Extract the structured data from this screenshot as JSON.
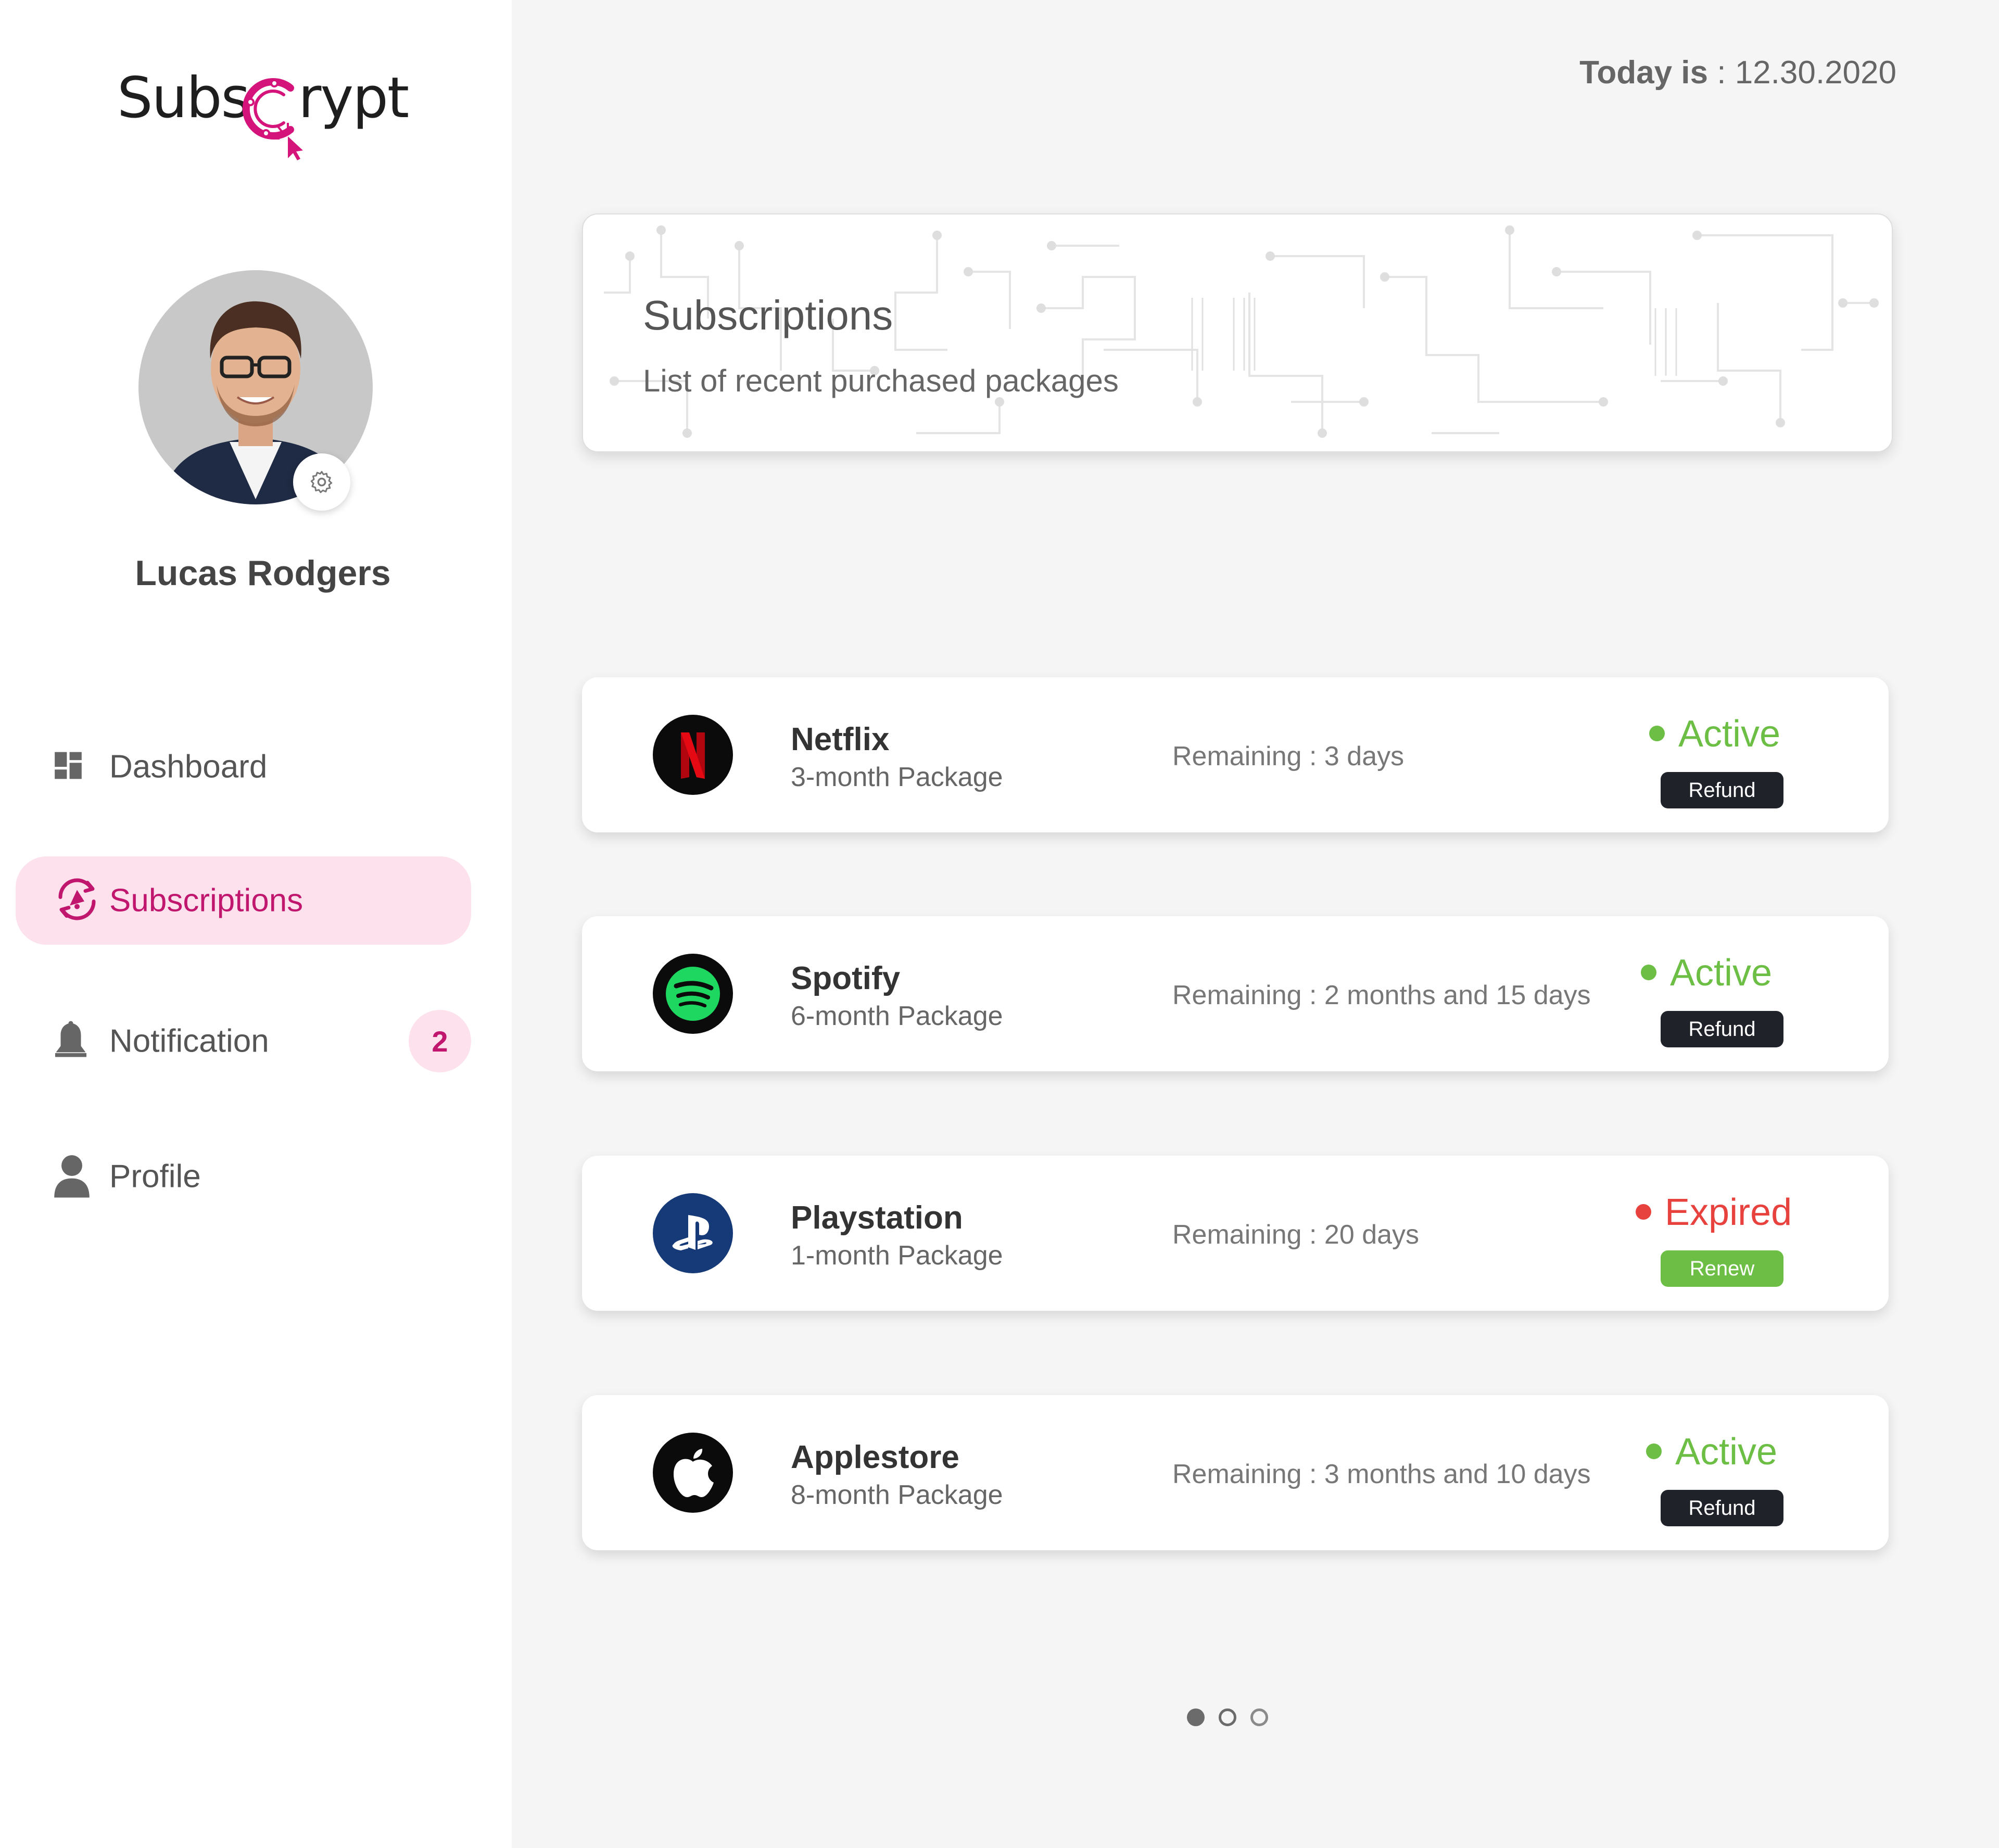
{
  "app": {
    "logo_text_left": "Subs",
    "logo_text_right": "rypt",
    "brand_color": "#d4147a"
  },
  "user": {
    "name": "Lucas Rodgers"
  },
  "nav": {
    "items": [
      {
        "label": "Dashboard",
        "icon": "dashboard-icon",
        "active": false
      },
      {
        "label": "Subscriptions",
        "icon": "subscriptions-icon",
        "active": true
      },
      {
        "label": "Notification",
        "icon": "bell-icon",
        "active": false,
        "badge": "2"
      },
      {
        "label": "Profile",
        "icon": "person-icon",
        "active": false
      }
    ]
  },
  "header": {
    "today_label": "Today is",
    "today_value": " : 12.30.2020",
    "title": "Subscriptions",
    "subtitle": "List of recent purchased packages"
  },
  "subscriptions": [
    {
      "name": "Netflix",
      "package": "3-month Package",
      "remaining": "Remaining : 3 days",
      "status": "Active",
      "status_color": "#6cbe45",
      "action": "Refund",
      "action_color": "#1f2329",
      "logo": "netflix-logo-icon"
    },
    {
      "name": "Spotify",
      "package": "6-month Package",
      "remaining": "Remaining : 2 months and 15 days",
      "status": "Active",
      "status_color": "#6cbe45",
      "action": "Refund",
      "action_color": "#1f2329",
      "logo": "spotify-logo-icon"
    },
    {
      "name": "Playstation",
      "package": "1-month Package",
      "remaining": "Remaining : 20 days",
      "status": "Expired",
      "status_color": "#e8423f",
      "action": "Renew",
      "action_color": "#6cbe45",
      "logo": "playstation-logo-icon"
    },
    {
      "name": "Applestore",
      "package": "8-month Package",
      "remaining": "Remaining : 3 months and 10 days",
      "status": "Active",
      "status_color": "#6cbe45",
      "action": "Refund",
      "action_color": "#1f2329",
      "logo": "apple-logo-icon"
    }
  ],
  "pagination": {
    "pages": 3,
    "current": 1
  }
}
